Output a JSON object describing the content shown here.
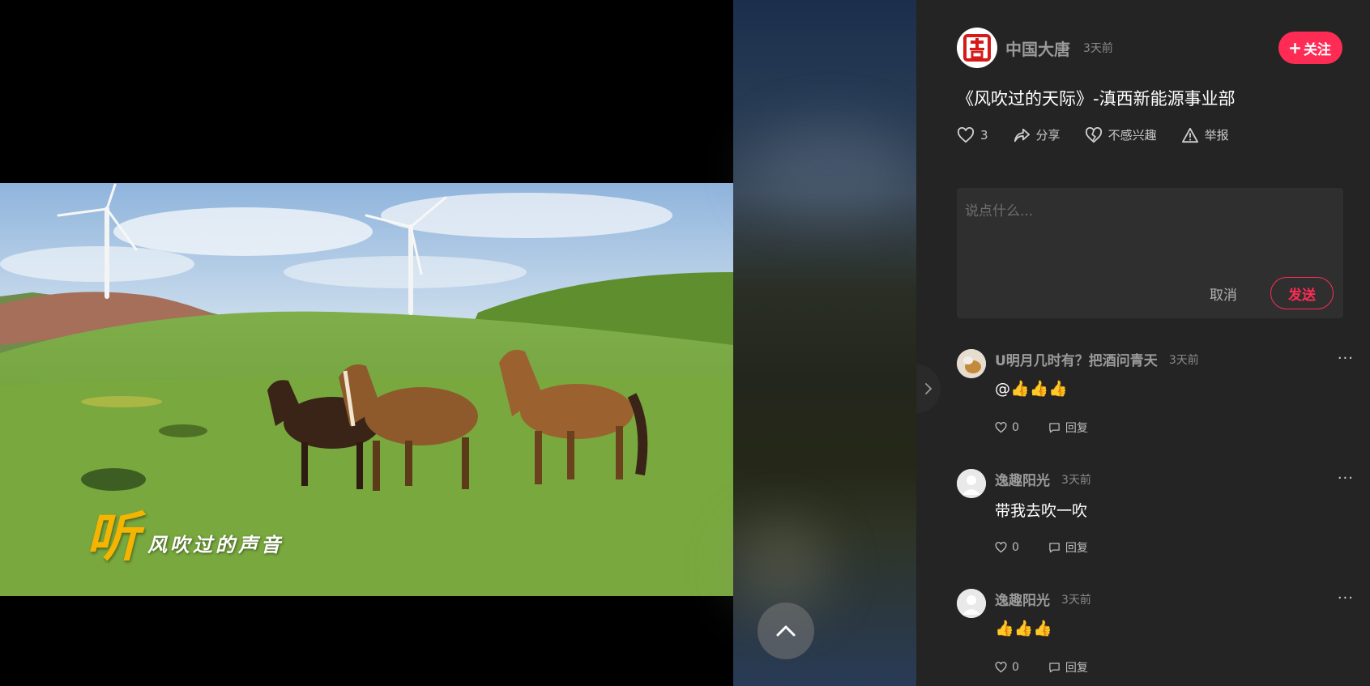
{
  "video": {
    "caption_big": "听",
    "caption_small": "风吹过的声音"
  },
  "author": {
    "name": "中国大唐",
    "time": "3天前",
    "follow_label": "关注"
  },
  "title": "《风吹过的天际》-滇西新能源事业部",
  "actions": {
    "like_count": "3",
    "share_label": "分享",
    "dislike_label": "不感兴趣",
    "report_label": "举报"
  },
  "comment_box": {
    "placeholder": "说点什么...",
    "cancel_label": "取消",
    "send_label": "发送"
  },
  "comments": [
    {
      "name": "U明月几时有？把酒问青天",
      "time": "3天前",
      "text": "@👍👍👍",
      "likes": "0",
      "reply_label": "回复"
    },
    {
      "name": "逸趣阳光",
      "time": "3天前",
      "text": "带我去吹一吹",
      "likes": "0",
      "reply_label": "回复"
    },
    {
      "name": "逸趣阳光",
      "time": "3天前",
      "text": "👍👍👍",
      "likes": "0",
      "reply_label": "回复"
    }
  ],
  "colors": {
    "accent": "#fe2c55",
    "panel_bg": "#242424",
    "caption_yellow": "#f5b400"
  },
  "icons": {
    "like": "heart-icon",
    "share": "share-icon",
    "dislike": "broken-heart-icon",
    "report": "warning-icon",
    "more": "more-icon",
    "reply": "comment-icon",
    "scroll_top": "chevron-up-icon",
    "collapse": "chevron-right-icon"
  }
}
